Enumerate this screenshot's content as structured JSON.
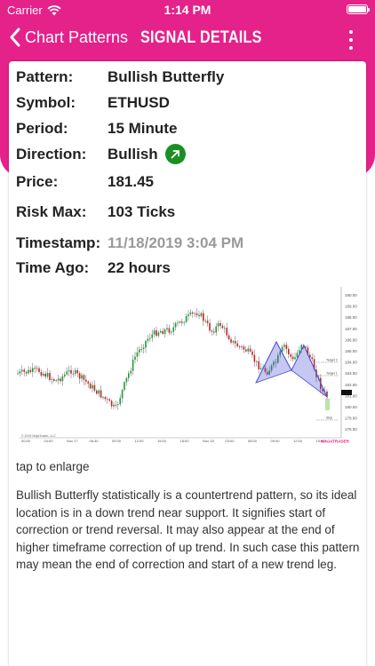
{
  "status": {
    "carrier": "Carrier",
    "time": "1:14 PM"
  },
  "nav": {
    "back_label": "Chart Patterns",
    "title": "SIGNAL DETAILS"
  },
  "details": {
    "pattern": {
      "label": "Pattern:",
      "value": "Bullish Butterfly"
    },
    "symbol": {
      "label": "Symbol:",
      "value": "ETHUSD"
    },
    "period": {
      "label": "Period:",
      "value": "15 Minute"
    },
    "direction": {
      "label": "Direction:",
      "value": "Bullish"
    },
    "price": {
      "label": "Price:",
      "value": "181.45"
    },
    "risk": {
      "label": "Risk Max:",
      "value": "103 Ticks"
    },
    "timestamp": {
      "label": "Timestamp:",
      "value": "11/18/2019 3:04 PM"
    },
    "time_ago": {
      "label": "Time Ago:",
      "value": "22 hours"
    }
  },
  "chart": {
    "price_labels": [
      "190.00",
      "189.00",
      "188.00",
      "187.00",
      "186.00",
      "185.00",
      "184.00",
      "183.00",
      "182.00",
      "181.00",
      "180.00",
      "179.00",
      "178.00"
    ],
    "time_labels": [
      "00:00",
      "04:00",
      "Nov 17",
      "06:30",
      "09:30",
      "12:00",
      "15:00",
      "18:00",
      "Nov 18",
      "03:00",
      "06:00",
      "09:00",
      "12:00",
      "15:00"
    ],
    "annotations": [
      "Target 2",
      "Target 1",
      "Stop"
    ],
    "copyright": "© 2019 NinjaTrader, LLC",
    "brand": "NINJATRADER",
    "colors": {
      "up": "#1e9a3c",
      "down": "#c42424",
      "pattern": "#4d55d6"
    }
  },
  "tap_text": "tap to enlarge",
  "description": "Bullish Butterfly statistically is a countertrend pattern,  so its ideal location is in a down trend near support. It signifies start of correction or trend reversal. It may also appear at the end of higher timeframe correction of up trend. In such case this pattern may mean the end of correction and start of a new trend leg."
}
